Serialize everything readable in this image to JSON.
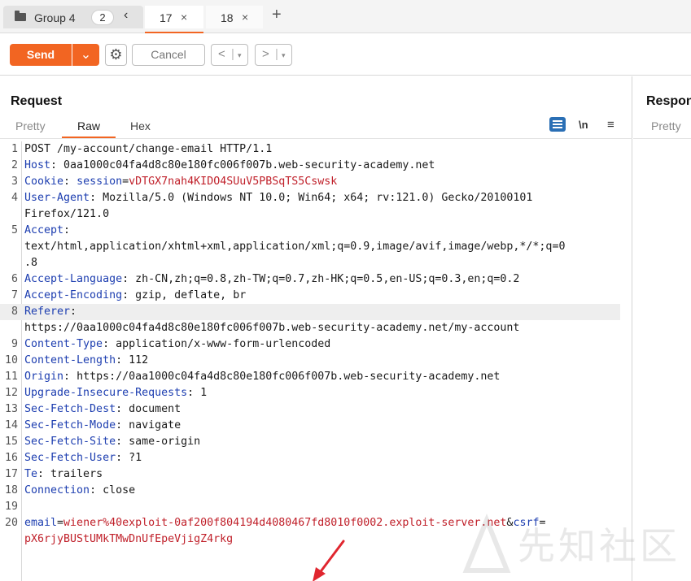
{
  "tabs": {
    "group": {
      "label": "Group 4",
      "count": "2",
      "collapse": "‹"
    },
    "items": [
      {
        "label": "17",
        "close": "×"
      },
      {
        "label": "18",
        "close": "×"
      }
    ],
    "add": "+"
  },
  "toolbar": {
    "send_label": "Send",
    "send_dropdown": "⌄",
    "settings_glyph": "⚙",
    "cancel_label": "Cancel",
    "back_glyph": "<",
    "forward_glyph": ">",
    "nav_sep": "|",
    "nav_caret": "▾"
  },
  "request": {
    "title": "Request",
    "subtabs": [
      "Pretty",
      "Raw",
      "Hex"
    ],
    "icons": {
      "newline": "\\n",
      "menu": "≡"
    },
    "lines": [
      {
        "n": "1",
        "text": "POST /my-account/change-email HTTP/1.1"
      },
      {
        "n": "2",
        "key": "Host",
        "sep": ": ",
        "value": "0aa1000c04fa4d8c80e180fc006f007b.web-security-academy.net"
      },
      {
        "n": "3",
        "key": "Cookie",
        "sep": ": ",
        "pkey": "session",
        "eq": "=",
        "pval": "vDTGX7nah4KIDO4SUuV5PBSqTS5Cswsk"
      },
      {
        "n": "4",
        "key": "User-Agent",
        "sep": ": ",
        "value": "Mozilla/5.0 (Windows NT 10.0; Win64; x64; rv:121.0) Gecko/20100101"
      },
      {
        "n": "",
        "value": "Firefox/121.0"
      },
      {
        "n": "5",
        "key": "Accept",
        "sep": ":"
      },
      {
        "n": "",
        "value": "text/html,application/xhtml+xml,application/xml;q=0.9,image/avif,image/webp,*/*;q=0"
      },
      {
        "n": "",
        "value": ".8"
      },
      {
        "n": "6",
        "key": "Accept-Language",
        "sep": ": ",
        "value": "zh-CN,zh;q=0.8,zh-TW;q=0.7,zh-HK;q=0.5,en-US;q=0.3,en;q=0.2"
      },
      {
        "n": "7",
        "key": "Accept-Encoding",
        "sep": ": ",
        "value": "gzip, deflate, br"
      },
      {
        "n": "8",
        "key": "Referer",
        "sep": ":",
        "highlight": true
      },
      {
        "n": "",
        "value": "https://0aa1000c04fa4d8c80e180fc006f007b.web-security-academy.net/my-account"
      },
      {
        "n": "9",
        "key": "Content-Type",
        "sep": ": ",
        "value": "application/x-www-form-urlencoded"
      },
      {
        "n": "10",
        "key": "Content-Length",
        "sep": ": ",
        "value": "112"
      },
      {
        "n": "11",
        "key": "Origin",
        "sep": ": ",
        "value": "https://0aa1000c04fa4d8c80e180fc006f007b.web-security-academy.net"
      },
      {
        "n": "12",
        "key": "Upgrade-Insecure-Requests",
        "sep": ": ",
        "value": "1"
      },
      {
        "n": "13",
        "key": "Sec-Fetch-Dest",
        "sep": ": ",
        "value": "document"
      },
      {
        "n": "14",
        "key": "Sec-Fetch-Mode",
        "sep": ": ",
        "value": "navigate"
      },
      {
        "n": "15",
        "key": "Sec-Fetch-Site",
        "sep": ": ",
        "value": "same-origin"
      },
      {
        "n": "16",
        "key": "Sec-Fetch-User",
        "sep": ": ",
        "value": "?1"
      },
      {
        "n": "17",
        "key": "Te",
        "sep": ": ",
        "value": "trailers"
      },
      {
        "n": "18",
        "key": "Connection",
        "sep": ": ",
        "value": "close"
      },
      {
        "n": "19"
      },
      {
        "n": "20",
        "pkey": "email",
        "eq": "=",
        "pval": "wiener%40exploit-0af200f804194d4080467fd8010f0002.exploit-server.net",
        "amp": "&",
        "pkey2": "csrf",
        "eq2": "="
      },
      {
        "n": "",
        "pval": "pX6rjyBUStUMkTMwDnUfEpeVjigZ4rkg"
      }
    ]
  },
  "response": {
    "title": "Response",
    "subtab": "Pretty"
  },
  "watermark": "先知社区",
  "colors": {
    "accent": "#f26522",
    "header_key": "#1d3eb0",
    "param_value": "#c0202a",
    "annotation": "#e0262f"
  }
}
